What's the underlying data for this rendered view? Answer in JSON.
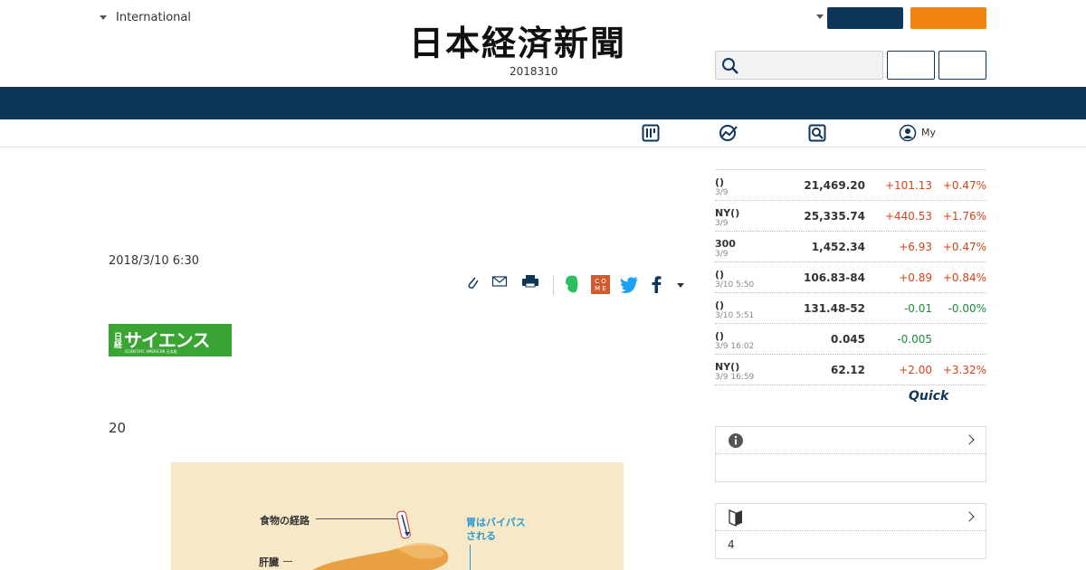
{
  "header": {
    "region": "International",
    "logo_text": "日本経済新聞",
    "date": "2018310"
  },
  "subnav": {
    "my_label": "My"
  },
  "article": {
    "date": "2018/3/10 6:30",
    "lead_text": "20",
    "figure_labels": {
      "food_path": "食物の経路",
      "liver": "肝臓",
      "bypass": "胃はバイパス\nされる"
    }
  },
  "market": {
    "rows": [
      {
        "name": "()",
        "time": "3/9",
        "value": "21,469.20",
        "change": "+101.13",
        "pct": "+0.47%",
        "dir": "up"
      },
      {
        "name": "NY()",
        "time": "3/9",
        "value": "25,335.74",
        "change": "+440.53",
        "pct": "+1.76%",
        "dir": "up"
      },
      {
        "name": "300",
        "time": "3/9",
        "value": "1,452.34",
        "change": "+6.93",
        "pct": "+0.47%",
        "dir": "up"
      },
      {
        "name": "()",
        "time": "3/10 5:50",
        "value": "106.83-84",
        "change": "+0.89",
        "pct": "+0.84%",
        "dir": "up"
      },
      {
        "name": "()",
        "time": "3/10 5:51",
        "value": "131.48-52",
        "change": "-0.01",
        "pct": "-0.00%",
        "dir": "down"
      },
      {
        "name": "()",
        "time": "3/9 16:02",
        "value": "0.045",
        "change": "-0.005",
        "pct": "",
        "dir": "down"
      },
      {
        "name": "NY()",
        "time": "3/9 16:59",
        "value": "62.12",
        "change": "+2.00",
        "pct": "+3.32%",
        "dir": "up"
      }
    ],
    "provider": "Quick"
  },
  "panels": {
    "second_body": "4"
  },
  "colors": {
    "navy": "#0d3659",
    "orange": "#f0830f",
    "up": "#d2441a",
    "down": "#1f8a3a",
    "science_green": "#3aa535"
  },
  "science_logo": {
    "kanji": "日経",
    "title": "サイエンス",
    "subtitle": "SCIENTIFIC AMERICAN 日本版"
  }
}
